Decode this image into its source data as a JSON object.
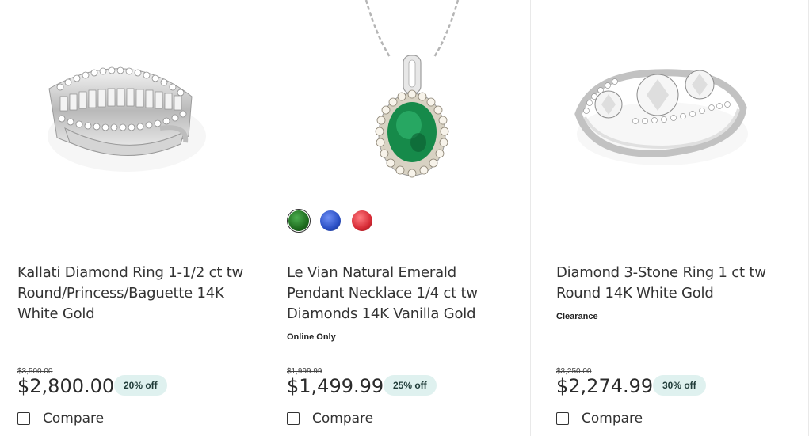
{
  "products": [
    {
      "title": "Kallati Diamond Ring 1-1/2 ct tw Round/Princess/Baguette 14K White Gold",
      "tag": "",
      "was_price": "$3,500.00",
      "price": "$2,800.00",
      "discount": "20% off",
      "compare_label": "Compare",
      "image_icon": "diamond-band-ring"
    },
    {
      "title": "Le Vian Natural Emerald Pendant Necklace 1/4 ct tw Diamonds 14K Vanilla Gold",
      "tag": "Online Only",
      "was_price": "$1,999.99",
      "price": "$1,499.99",
      "discount": "25% off",
      "compare_label": "Compare",
      "image_icon": "emerald-pendant-necklace",
      "swatches": [
        {
          "name": "emerald",
          "color": "#1e6b1e",
          "selected": true
        },
        {
          "name": "sapphire",
          "color": "#2a4fc4",
          "selected": false
        },
        {
          "name": "ruby",
          "color": "#d62a35",
          "selected": false
        }
      ]
    },
    {
      "title": "Diamond 3-Stone Ring 1 ct tw Round 14K White Gold",
      "tag": "Clearance",
      "was_price": "$3,250.00",
      "price": "$2,274.99",
      "discount": "30% off",
      "compare_label": "Compare",
      "image_icon": "three-stone-ring"
    }
  ],
  "colors": {
    "discount_bg": "#dff1ef",
    "text": "#333333",
    "border": "#e9e9e9"
  }
}
